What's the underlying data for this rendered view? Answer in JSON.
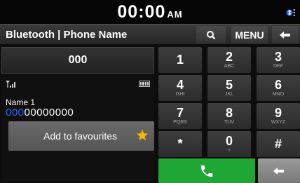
{
  "status": {
    "time": "00:00",
    "ampm": "AM"
  },
  "titlebar": {
    "title": "Bluetooth | Phone Name",
    "menu_label": "MENU"
  },
  "dial": {
    "number": "000"
  },
  "contact": {
    "name": "Name 1",
    "number_highlight": "000",
    "number_rest": "00000000"
  },
  "favourites": {
    "label": "Add to favourites"
  },
  "keypad": {
    "keys": [
      {
        "main": "1",
        "sub": ""
      },
      {
        "main": "2",
        "sub": "ABC"
      },
      {
        "main": "3",
        "sub": "DEF"
      },
      {
        "main": "4",
        "sub": "GHI"
      },
      {
        "main": "5",
        "sub": "JKL"
      },
      {
        "main": "6",
        "sub": "MNO"
      },
      {
        "main": "7",
        "sub": "PQRS"
      },
      {
        "main": "8",
        "sub": "TUV"
      },
      {
        "main": "9",
        "sub": "WXYZ"
      },
      {
        "main": "*",
        "sub": ""
      },
      {
        "main": "0",
        "sub": "+"
      },
      {
        "main": "#",
        "sub": ""
      }
    ]
  },
  "colors": {
    "call_green": "#1fa634",
    "highlight_blue": "#2b6bff",
    "star_yellow": "#f5b800"
  },
  "icons": [
    "bluetooth-icon",
    "search-icon",
    "back-arrow-icon",
    "signal-icon",
    "battery-icon",
    "star-icon",
    "phone-icon",
    "backspace-icon"
  ]
}
